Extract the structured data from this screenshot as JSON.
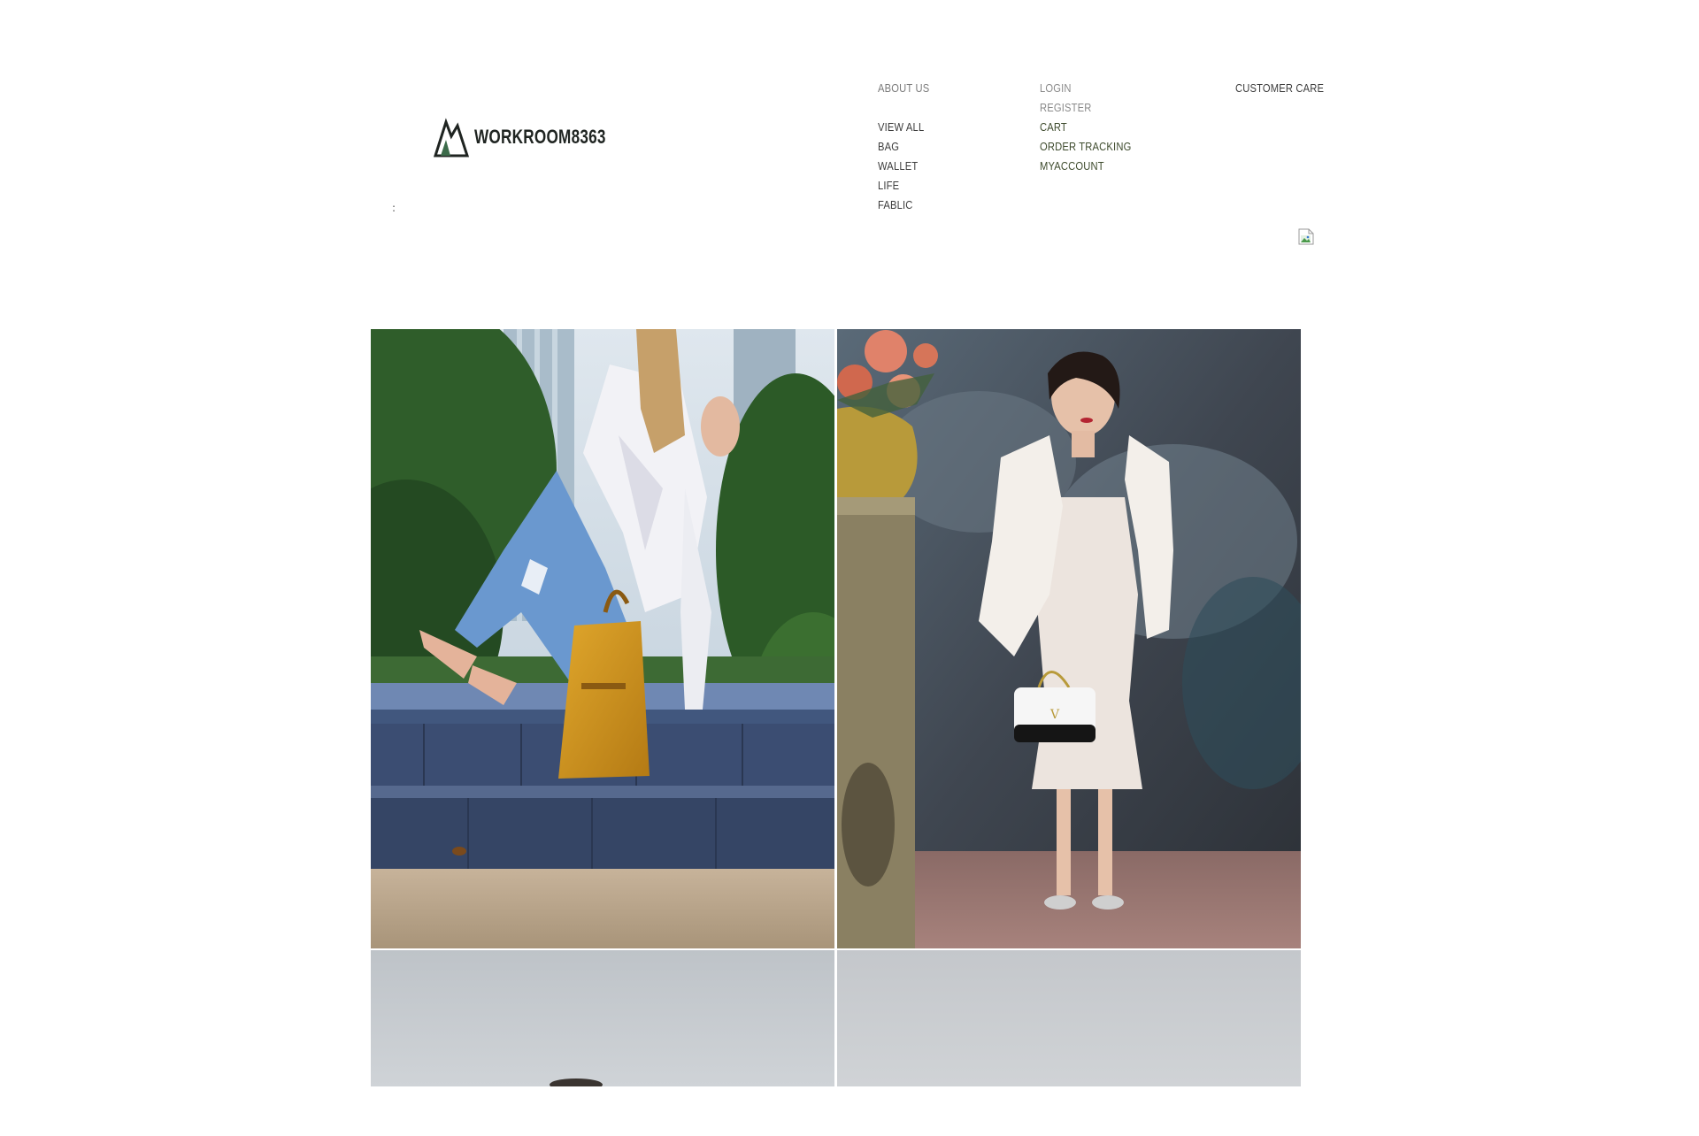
{
  "header": {
    "logo_text": "WORKROOM8363",
    "colon": ":"
  },
  "nav": {
    "about": "ABOUT US",
    "shop": [
      "VIEW ALL",
      "BAG",
      "WALLET",
      "LIFE",
      "FABLIC"
    ],
    "account": [
      "LOGIN",
      "REGISTER",
      "CART",
      "ORDER TRACKING",
      "MYACCOUNT"
    ],
    "customer_care": "CUSTOMER CARE"
  },
  "gallery": {
    "tiles": [
      {
        "icon": "photo-woman-sitting-with-mustard-tote-bag"
      },
      {
        "icon": "photo-woman-white-dress-with-handbag"
      },
      {
        "icon": "photo-grey-sky-partial"
      },
      {
        "icon": "photo-grey-sky-partial"
      }
    ]
  },
  "colors": {
    "text": "#3c3c3c",
    "muted": "#7b7b7b",
    "account_text": "#3d4a2c",
    "logo": "#1f2421"
  }
}
